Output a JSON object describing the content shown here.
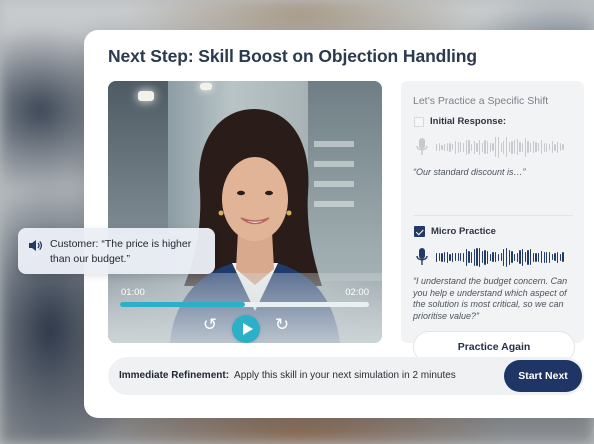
{
  "card": {
    "title": "Next Step: Skill Boost on Objection Handling"
  },
  "video": {
    "time_current": "01:00",
    "time_total": "02:00",
    "progress": 0.5,
    "accent_color": "#2bb0c8"
  },
  "customer_bubble": {
    "icon": "speaker-icon",
    "text": "Customer: “The price is higher than our budget.”"
  },
  "practice_panel": {
    "heading": "Let’s Practice a Specific Shift",
    "initial": {
      "label": "Initial Response:",
      "checked": false,
      "quote": "“Our standard discount is…”",
      "wave_color": "#c6c9ce"
    },
    "micro": {
      "label": "Micro Practice",
      "checked": true,
      "quote": "“I understand the budget concern. Can you help e understand which aspect of the solution is most critical, so we can prioritise value?”",
      "wave_color": "#243a66"
    },
    "button_label": "Practice Again"
  },
  "refinement": {
    "label": "Immediate Refinement:",
    "text": "Apply this skill in your next simulation in 2 minutes",
    "button_label": "Start Next",
    "button_color": "#1f3566"
  }
}
